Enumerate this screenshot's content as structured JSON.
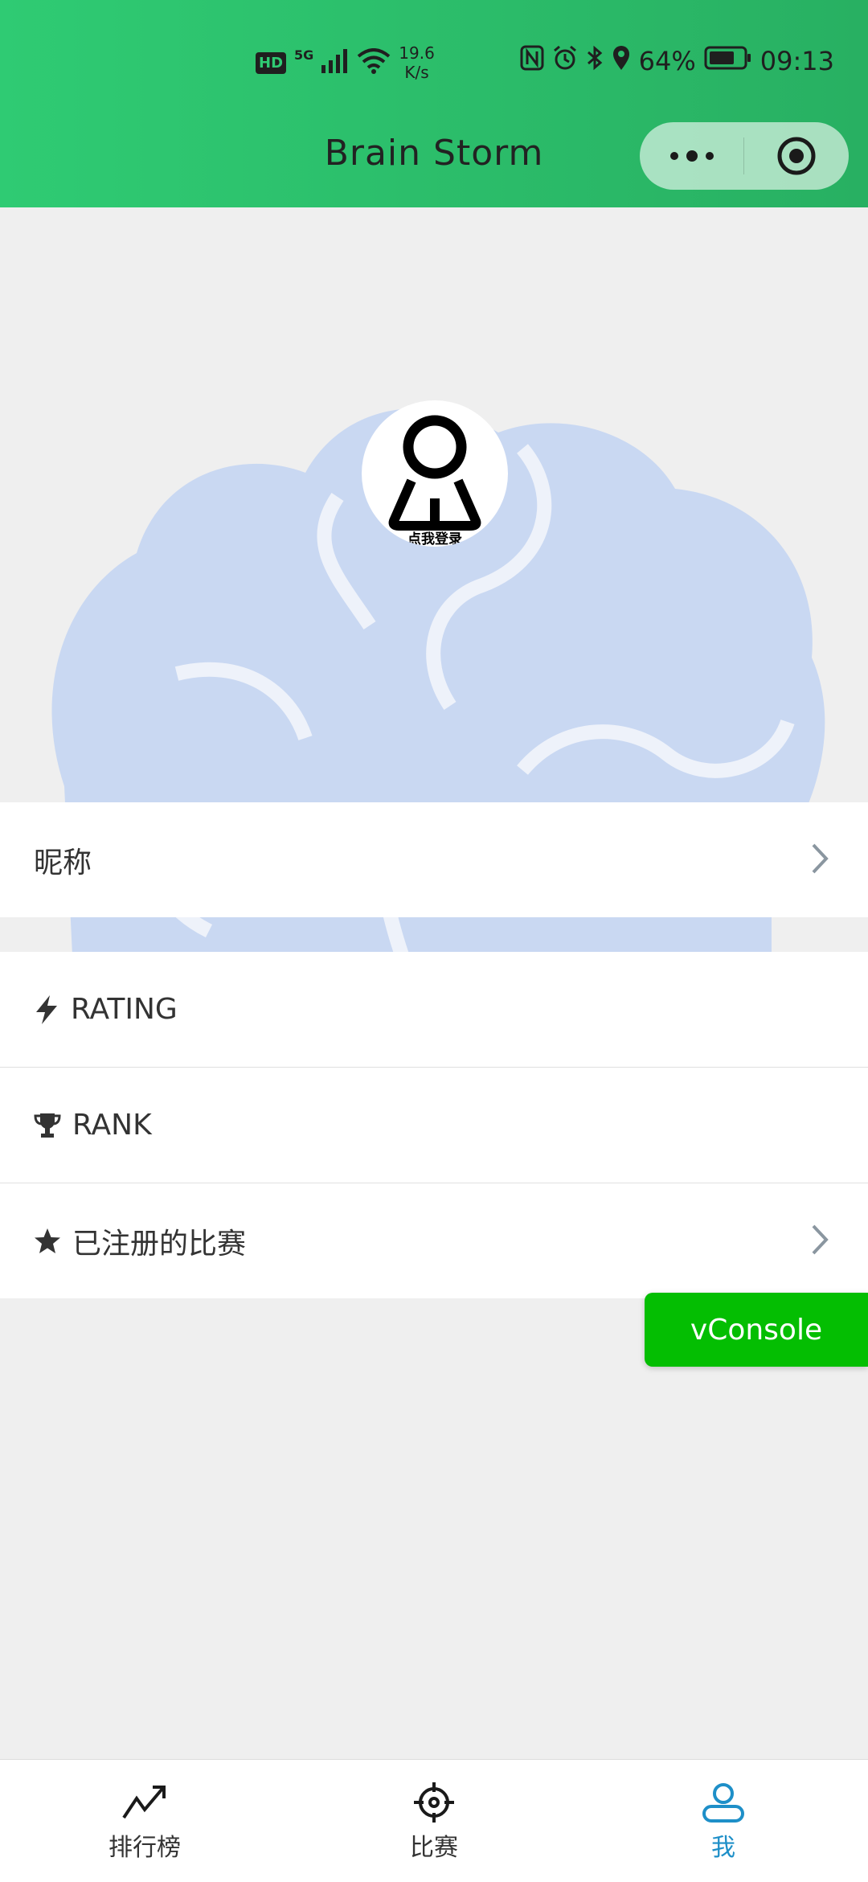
{
  "status_bar": {
    "hd": "HD",
    "network": "5G",
    "speed_value": "19.6",
    "speed_unit": "K/s",
    "battery": "64%",
    "time": "09:13"
  },
  "header": {
    "title": "Brain Storm"
  },
  "avatar": {
    "login_text": "点我登录"
  },
  "rows": {
    "nickname": "昵称",
    "rating": "RATING",
    "rank": "RANK",
    "registered": "已注册的比赛"
  },
  "vconsole": {
    "label": "vConsole"
  },
  "tabbar": {
    "items": [
      {
        "label": "排行榜",
        "icon": "trend-chart-icon"
      },
      {
        "label": "比赛",
        "icon": "crosshair-icon"
      },
      {
        "label": "我",
        "icon": "user-icon"
      }
    ],
    "active_index": 2
  },
  "colors": {
    "header_green": "#2fcb73",
    "vconsole_green": "#04be02",
    "active_tab": "#1e8fc8",
    "brain_bg": "#c9d8f2"
  }
}
